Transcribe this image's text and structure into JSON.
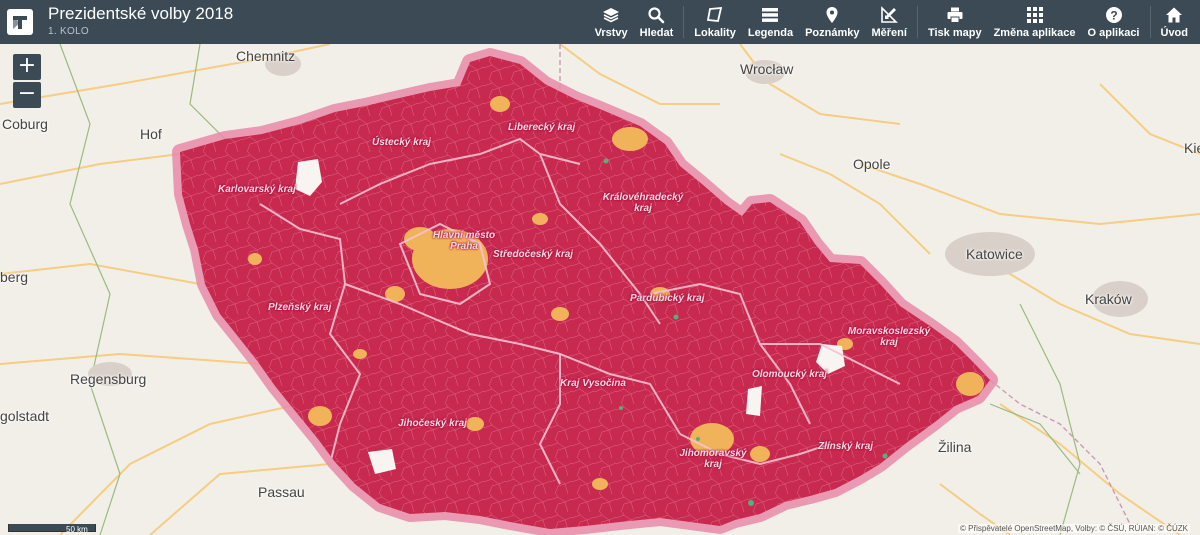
{
  "header": {
    "title": "Prezidentské volby 2018",
    "subtitle": "1. KOLO"
  },
  "toolbar": [
    {
      "label": "Vrstvy",
      "icon": "layers-icon"
    },
    {
      "label": "Hledat",
      "icon": "search-icon"
    },
    {
      "label": "Lokality",
      "icon": "polygon-icon"
    },
    {
      "label": "Legenda",
      "icon": "list-icon"
    },
    {
      "label": "Poznámky",
      "icon": "map-pin-icon"
    },
    {
      "label": "Měření",
      "icon": "ruler-icon"
    },
    {
      "label": "Tisk mapy",
      "icon": "printer-icon"
    },
    {
      "label": "Změna aplikace",
      "icon": "grid-icon"
    },
    {
      "label": "O aplikaci",
      "icon": "help-icon"
    },
    {
      "label": "Úvod",
      "icon": "home-icon"
    }
  ],
  "zoom": {
    "in": "+",
    "out": "−"
  },
  "scale_label": "50 km",
  "attribution": "© Přispěvatelé OpenStreetMap, Volby: © ČSÚ, RÚIAN: © ČÚZK",
  "cities": [
    "Chemnitz",
    "Wrocław",
    "Coburg",
    "Hof",
    "Opole",
    "Katowice",
    "Kraków",
    "Regensburg",
    "golstadt",
    "Passau",
    "Žilina",
    "berg",
    "Kie"
  ],
  "regions": [
    "Karlovarský kraj",
    "Ústecký kraj",
    "Liberecký kraj",
    "Královéhradecký kraj",
    "Hlavní město Praha",
    "Středočeský kraj",
    "Plzeňský kraj",
    "Pardubický kraj",
    "Moravskoslezský kraj",
    "Olomoucký kraj",
    "Kraj Vysočina",
    "Jihočeský kraj",
    "Jihomoravský kraj",
    "Zlínský kraj"
  ],
  "colors": {
    "header": "#3b4a55",
    "winner_fill": "#c8294f",
    "other_fill": "#f0b35a",
    "border_glow": "#e88aa8",
    "map_background": "#f2efe9"
  }
}
